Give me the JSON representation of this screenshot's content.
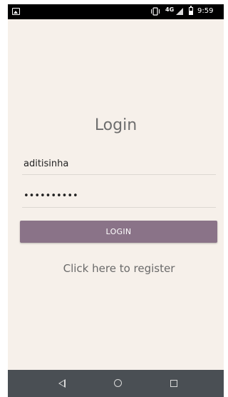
{
  "status_bar": {
    "network": "4G",
    "time": "9:59",
    "icons": [
      "image-icon",
      "vibrate-icon",
      "signal-icon",
      "battery-icon"
    ]
  },
  "login": {
    "title": "Login",
    "username_value": "aditisinha",
    "password_value": "••••••••••",
    "button_label": "LOGIN",
    "register_link": "Click here to register"
  },
  "nav_bar": {
    "icons": [
      "back-icon",
      "home-icon",
      "recents-icon"
    ]
  },
  "colors": {
    "background": "#f6f0ea",
    "button": "#8a7388",
    "nav_bar": "#4a4f54",
    "status_bar": "#000000"
  }
}
